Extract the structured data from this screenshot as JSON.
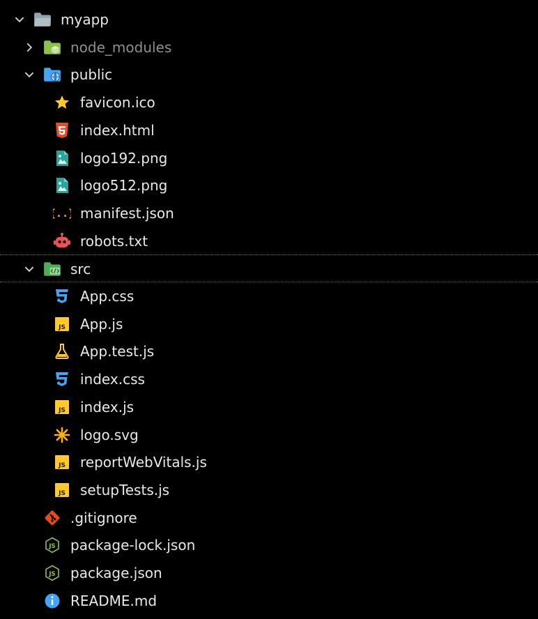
{
  "tree": [
    {
      "label": "myapp",
      "depth": 0,
      "type": "folder",
      "expanded": true,
      "icon": "folder-icon"
    },
    {
      "label": "node_modules",
      "depth": 1,
      "type": "folder",
      "expanded": false,
      "icon": "node-modules-folder-icon",
      "muted": true
    },
    {
      "label": "public",
      "depth": 1,
      "type": "folder",
      "expanded": true,
      "icon": "public-folder-icon"
    },
    {
      "label": "favicon.ico",
      "depth": 2,
      "type": "file",
      "icon": "star-icon"
    },
    {
      "label": "index.html",
      "depth": 2,
      "type": "file",
      "icon": "html5-icon"
    },
    {
      "label": "logo192.png",
      "depth": 2,
      "type": "file",
      "icon": "image-icon"
    },
    {
      "label": "logo512.png",
      "depth": 2,
      "type": "file",
      "icon": "image-icon"
    },
    {
      "label": "manifest.json",
      "depth": 2,
      "type": "file",
      "icon": "json-braces-icon"
    },
    {
      "label": "robots.txt",
      "depth": 2,
      "type": "file",
      "icon": "robot-icon"
    },
    {
      "label": "src",
      "depth": 1,
      "type": "folder",
      "expanded": true,
      "icon": "src-folder-icon",
      "selected": true
    },
    {
      "label": "App.css",
      "depth": 2,
      "type": "file",
      "icon": "css-icon"
    },
    {
      "label": "App.js",
      "depth": 2,
      "type": "file",
      "icon": "js-icon"
    },
    {
      "label": "App.test.js",
      "depth": 2,
      "type": "file",
      "icon": "test-flask-icon"
    },
    {
      "label": "index.css",
      "depth": 2,
      "type": "file",
      "icon": "css-icon"
    },
    {
      "label": "index.js",
      "depth": 2,
      "type": "file",
      "icon": "js-icon"
    },
    {
      "label": "logo.svg",
      "depth": 2,
      "type": "file",
      "icon": "svg-asterisk-icon"
    },
    {
      "label": "reportWebVitals.js",
      "depth": 2,
      "type": "file",
      "icon": "js-icon"
    },
    {
      "label": "setupTests.js",
      "depth": 2,
      "type": "file",
      "icon": "js-icon"
    },
    {
      "label": ".gitignore",
      "depth": 1,
      "type": "file",
      "icon": "git-icon"
    },
    {
      "label": "package-lock.json",
      "depth": 1,
      "type": "file",
      "icon": "nodejs-icon"
    },
    {
      "label": "package.json",
      "depth": 1,
      "type": "file",
      "icon": "nodejs-icon"
    },
    {
      "label": "README.md",
      "depth": 1,
      "type": "file",
      "icon": "info-icon"
    }
  ],
  "colors": {
    "background": "#000000",
    "text": "#e8e8e8",
    "muted_text": "#8f8f8f",
    "separator": "#707070",
    "folder_gray": "#90a4ae",
    "node_green": "#8bc34a",
    "public_blue": "#42a5f5",
    "src_green": "#4caf50",
    "star_yellow": "#ffca28",
    "html_orange": "#e44d26",
    "image_teal": "#26a69a",
    "json_yellow": "#f9a825",
    "robot_red": "#ef5350",
    "css_blue": "#42a5f5",
    "js_yellow": "#ffca28",
    "svg_amber": "#ffb300",
    "git_orange": "#e64a19",
    "nodejs_green": "#8bc34a",
    "info_blue": "#42a5f5"
  }
}
